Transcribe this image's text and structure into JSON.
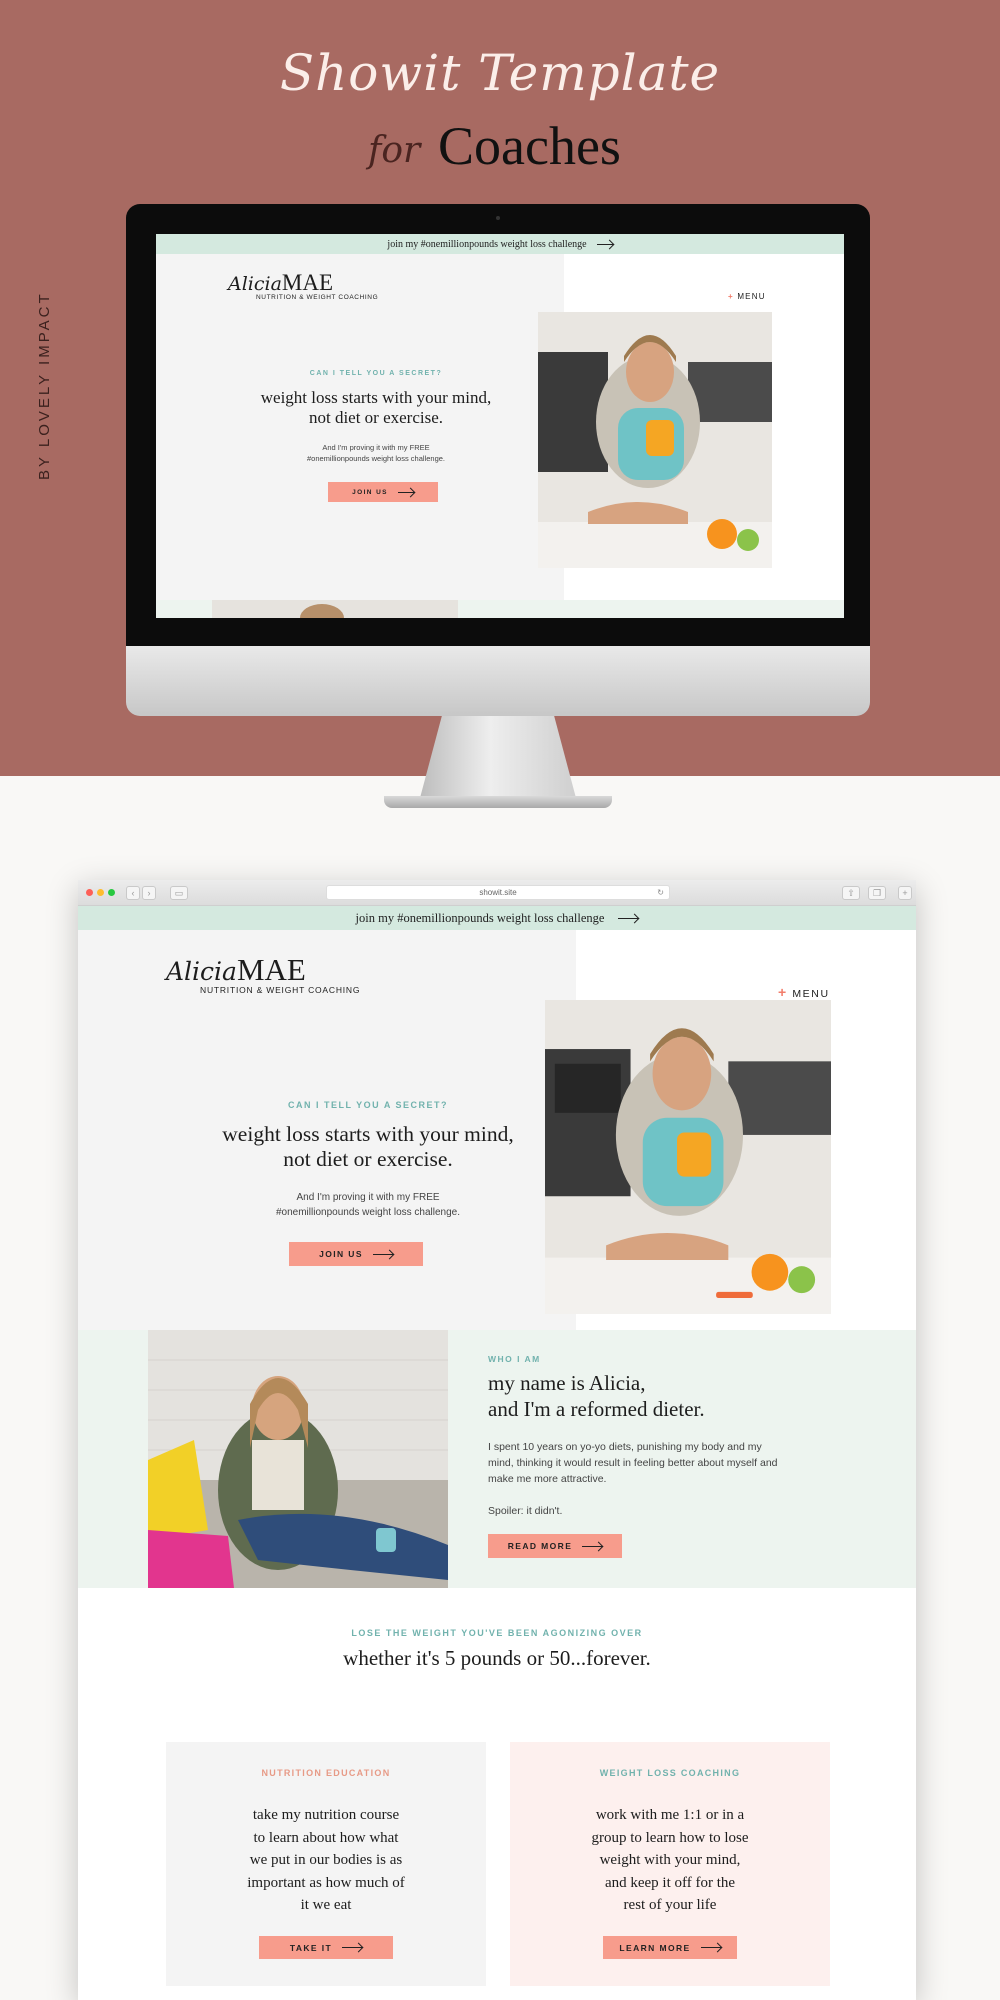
{
  "hero_banner": {
    "script_title": "Showit Template",
    "for_word": "for",
    "headline": "Coaches",
    "byline": "BY LOVELY IMPACT"
  },
  "site": {
    "announcement": "join my #onemillionpounds weight loss challenge",
    "logo_script": "Alicia",
    "logo_name": "MAE",
    "logo_tagline": "NUTRITION & WEIGHT COACHING",
    "menu_label": "MENU",
    "hero": {
      "eyebrow": "CAN I TELL YOU A SECRET?",
      "headline_line1": "weight loss starts with your mind,",
      "headline_line2": "not diet or exercise.",
      "body_line1": "And I'm proving it with my FREE",
      "body_line2": "#onemillionpounds weight loss challenge.",
      "cta": "JOIN US"
    },
    "about": {
      "eyebrow": "WHO I AM",
      "headline_line1": "my name is Alicia,",
      "headline_line2": "and I'm a reformed dieter.",
      "body": "I spent 10 years on yo-yo diets, punishing my body and my mind, thinking it would result in feeling better about myself and make me more attractive.",
      "spoiler": "Spoiler: it didn't.",
      "cta": "READ MORE"
    },
    "offers": {
      "eyebrow": "LOSE THE WEIGHT YOU'VE BEEN AGONIZING OVER",
      "headline": "whether it's 5 pounds or 50...forever.",
      "cards": [
        {
          "eyebrow": "NUTRITION EDUCATION",
          "lines": [
            "take my nutrition course",
            "to learn about how what",
            "we put in our bodies is as",
            "important as how much of",
            "it we eat"
          ],
          "cta": "TAKE IT"
        },
        {
          "eyebrow": "WEIGHT LOSS COACHING",
          "lines": [
            "work with me 1:1 or in a",
            "group to learn how to lose",
            "weight with your mind,",
            "and keep it off for the",
            "rest of your life"
          ],
          "cta": "LEARN MORE"
        }
      ]
    }
  },
  "browser": {
    "url": "showit.site"
  },
  "colors": {
    "rose_background": "#a86a62",
    "mint": "#d4e9df",
    "salmon_button": "#f79c8c",
    "teal_eyebrow": "#71b2ad",
    "coral_eyebrow": "#e79a86",
    "pink_card": "#fdf0ee"
  }
}
